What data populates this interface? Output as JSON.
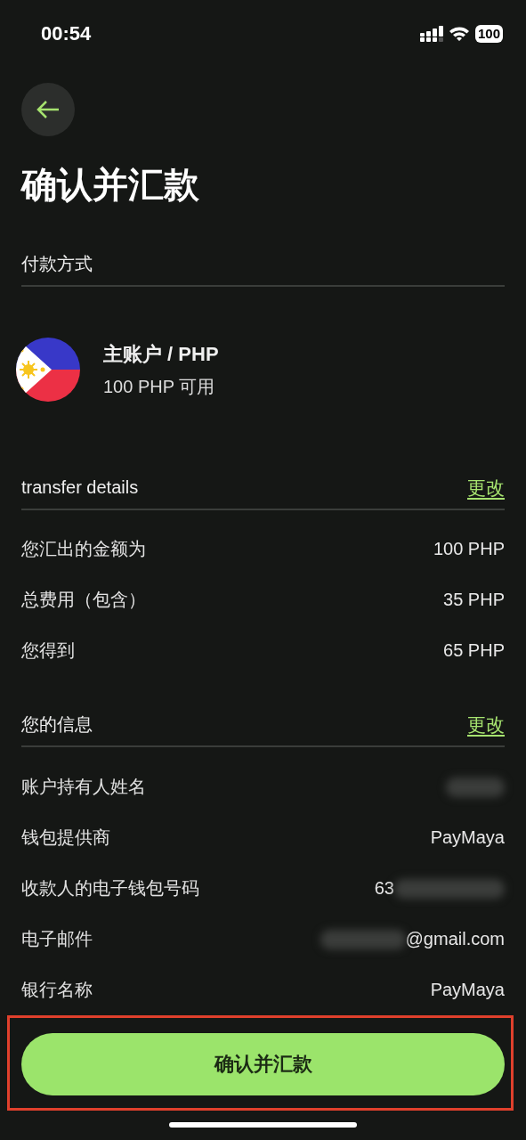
{
  "status_bar": {
    "time": "00:54",
    "battery": "100"
  },
  "title": "确认并汇款",
  "payment_section": {
    "heading": "付款方式"
  },
  "account": {
    "name": "主账户 / PHP",
    "balance": "100 PHP 可用"
  },
  "transfer_section": {
    "heading": "transfer details",
    "action": "更改",
    "rows": [
      {
        "label": "您汇出的金额为",
        "value": "100 PHP"
      },
      {
        "label": "总费用（包含）",
        "value": "35 PHP"
      },
      {
        "label": "您得到",
        "value": "65 PHP"
      }
    ]
  },
  "info_section": {
    "heading": "您的信息",
    "action": "更改",
    "rows": [
      {
        "label": "账户持有人姓名",
        "blur_after": true
      },
      {
        "label": "钱包提供商",
        "value": "PayMaya"
      },
      {
        "label": "收款人的电子钱包号码",
        "value": "63",
        "blur_after": true
      },
      {
        "label": "电子邮件",
        "value": "@gmail.com",
        "blur_before": true
      },
      {
        "label": "银行名称",
        "value": "PayMaya"
      }
    ]
  },
  "confirm_button": {
    "label": "确认并汇款",
    "highlighted": true
  }
}
